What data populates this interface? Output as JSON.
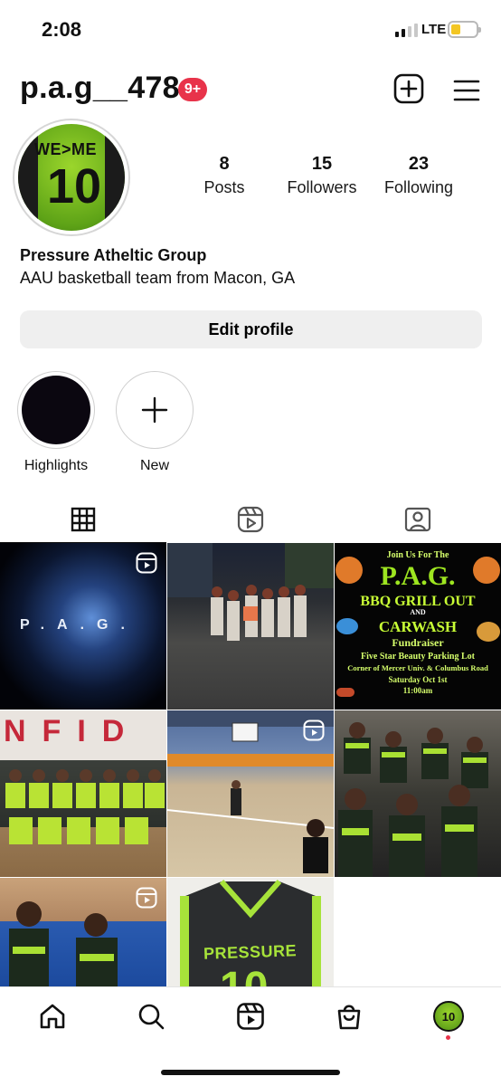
{
  "status_bar": {
    "time": "2:08",
    "network": "LTE"
  },
  "header": {
    "username": "p.a.g__478",
    "notification_badge": "9+"
  },
  "avatar": {
    "jersey_text": "WE>ME",
    "jersey_number": "10"
  },
  "stats": [
    {
      "count": "8",
      "label": "Posts"
    },
    {
      "count": "15",
      "label": "Followers"
    },
    {
      "count": "23",
      "label": "Following"
    }
  ],
  "bio": {
    "name": "Pressure Atheltic Group",
    "text": "AAU basketball team from Macon, GA"
  },
  "edit_profile_label": "Edit profile",
  "highlights": [
    {
      "label": "Highlights"
    },
    {
      "label": "New"
    }
  ],
  "tabs": [
    {
      "name": "grid-icon"
    },
    {
      "name": "reels-icon"
    },
    {
      "name": "tagged-icon"
    }
  ],
  "posts": {
    "p1_title": "P.A.G.",
    "p3": {
      "line1": "Join Us For The",
      "line2": "P.A.G.",
      "line3": "BBQ GRILL OUT",
      "line4": "AND",
      "line5": "CARWASH",
      "line6": "Fundraiser",
      "line7": "Five Star Beauty Parking Lot",
      "line8": "Corner of Mercer Univ. & Columbus Road",
      "line9": "Saturday Oct 1st",
      "line10": "11:00am"
    },
    "p4_banner": "NFID",
    "p8_jersey_word": "PRESSURE",
    "p8_jersey_number": "10"
  },
  "nav_avatar_text": "10"
}
